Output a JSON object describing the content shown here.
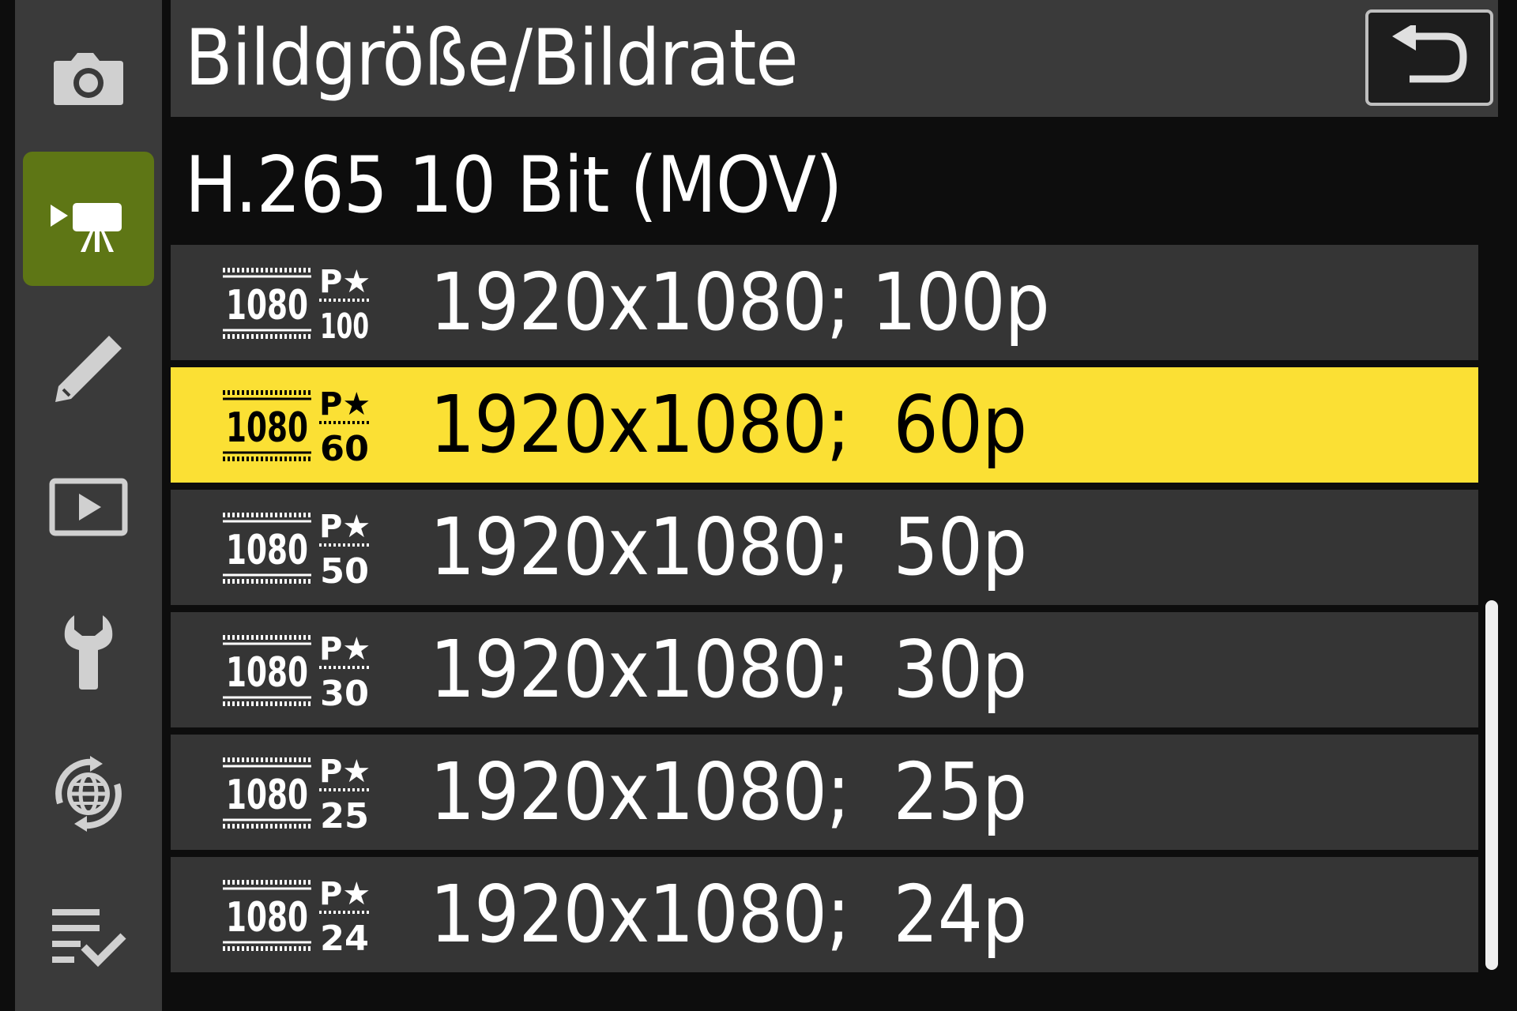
{
  "header": {
    "title": "Bildgröße/Bildrate",
    "back_icon": "return-arrow-icon"
  },
  "subtitle": "H.265 10 Bit (MOV)",
  "sidebar": {
    "tabs": [
      {
        "icon": "camera-icon",
        "active": false
      },
      {
        "icon": "movie-camera-icon",
        "active": true
      },
      {
        "icon": "pencil-icon",
        "active": false
      },
      {
        "icon": "playback-icon",
        "active": false
      },
      {
        "icon": "wrench-icon",
        "active": false
      },
      {
        "icon": "network-globe-icon",
        "active": false
      },
      {
        "icon": "my-menu-checklist-icon",
        "active": false
      }
    ]
  },
  "options": [
    {
      "label": "1920x1080; 100p",
      "icon_size": "1080",
      "icon_rate": "100",
      "icon_prefix": "P★",
      "selected": false
    },
    {
      "label": "1920x1080;  60p",
      "icon_size": "1080",
      "icon_rate": "60",
      "icon_prefix": "P★",
      "selected": true
    },
    {
      "label": "1920x1080;  50p",
      "icon_size": "1080",
      "icon_rate": "50",
      "icon_prefix": "P★",
      "selected": false
    },
    {
      "label": "1920x1080;  30p",
      "icon_size": "1080",
      "icon_rate": "30",
      "icon_prefix": "P★",
      "selected": false
    },
    {
      "label": "1920x1080;  25p",
      "icon_size": "1080",
      "icon_rate": "25",
      "icon_prefix": "P★",
      "selected": false
    },
    {
      "label": "1920x1080;  24p",
      "icon_size": "1080",
      "icon_rate": "24",
      "icon_prefix": "P★",
      "selected": false
    }
  ],
  "colors": {
    "selection": "#fbe034",
    "active_tab": "#5e7615",
    "panel": "#3a3a3a",
    "row": "#353535",
    "background": "#0d0d0d"
  },
  "scroll": {
    "fraction_visible": 0.55,
    "position": "bottom"
  }
}
